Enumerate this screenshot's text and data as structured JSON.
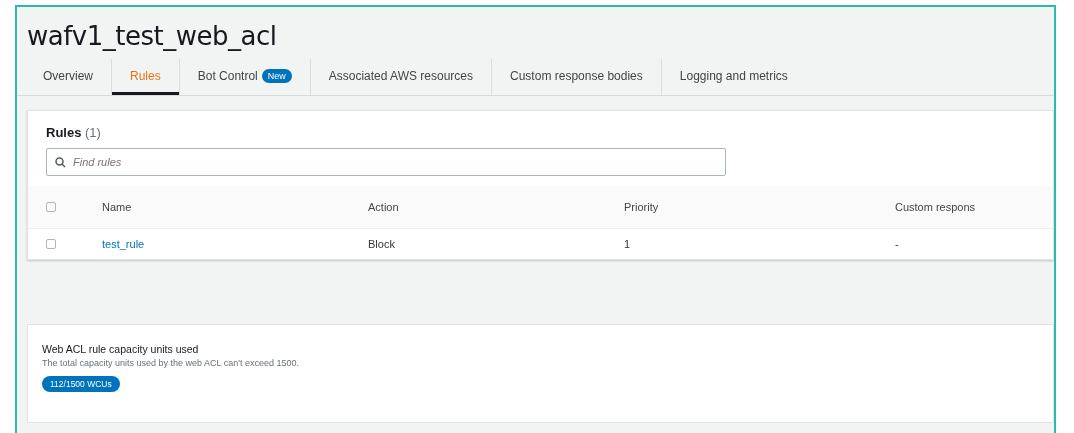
{
  "title": "wafv1_test_web_acl",
  "tabs": [
    {
      "label": "Overview",
      "selected": false
    },
    {
      "label": "Rules",
      "selected": true
    },
    {
      "label": "Bot Control",
      "selected": false,
      "badge": "New"
    },
    {
      "label": "Associated AWS resources",
      "selected": false
    },
    {
      "label": "Custom response bodies",
      "selected": false
    },
    {
      "label": "Logging and metrics",
      "selected": false
    }
  ],
  "rules": {
    "heading": "Rules",
    "count": "(1)",
    "search": {
      "placeholder": "Find rules"
    },
    "select_all_checked": false,
    "columns": [
      "Name",
      "Action",
      "Priority",
      "Custom respons"
    ],
    "rows": [
      {
        "checked": false,
        "name": "test_rule",
        "action": "Block",
        "priority": "1",
        "custom_response": "-"
      }
    ]
  },
  "capacity": {
    "title": "Web ACL rule capacity units used",
    "description": "The total capacity units used by the web ACL can't exceed 1500.",
    "badge": "112/1500 WCUs"
  }
}
